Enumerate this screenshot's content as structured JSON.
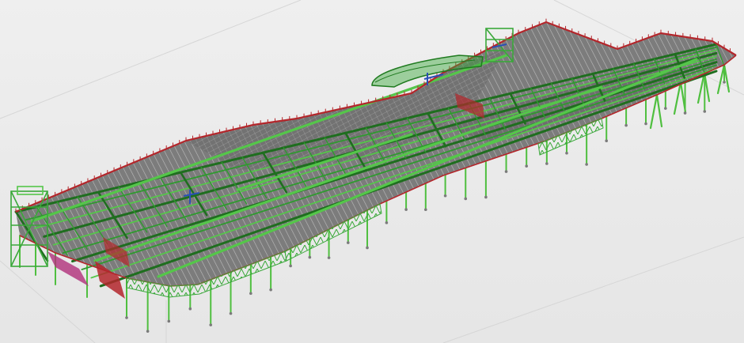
{
  "scene": {
    "subject": "steel-frame-model",
    "colors": {
      "background": "#ececec",
      "grid_line": "#d2d2d2",
      "slab_fill": "#6f6f6f",
      "slab_light": "#9a9a9a",
      "beam_green": "#2f9a2f",
      "beam_green_light": "#55c64a",
      "beam_green_dark": "#1f6e1f",
      "column_green": "#4fbf3f",
      "edge_red": "#b3262b",
      "accent_blue": "#2a4fb5",
      "accent_magenta": "#b0307a",
      "foot_gray": "#7a7a7a"
    }
  }
}
